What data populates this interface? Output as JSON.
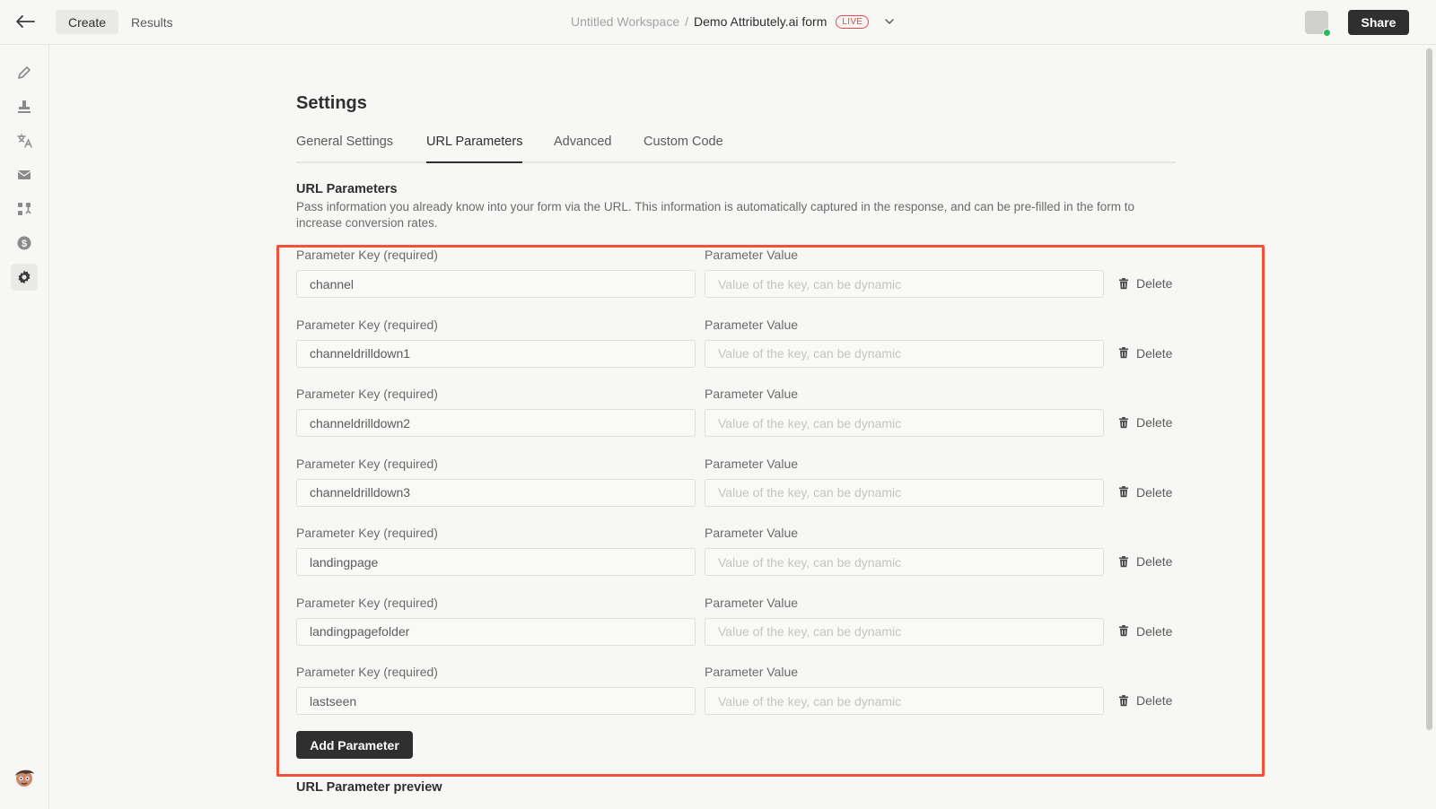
{
  "topbar": {
    "back_icon": "arrow-left-icon",
    "tab_create": "Create",
    "tab_results": "Results",
    "workspace": "Untitled Workspace",
    "separator": "/",
    "form_name": "Demo Attributely.ai form",
    "status_badge": "LIVE",
    "share_label": "Share"
  },
  "sidebar": {
    "icons": [
      "pencil-icon",
      "stamp-icon",
      "translate-icon",
      "mail-icon",
      "workflow-icon",
      "dollar-icon",
      "gear-icon"
    ],
    "active": "gear-icon"
  },
  "settings": {
    "title": "Settings",
    "tabs": [
      "General Settings",
      "URL Parameters",
      "Advanced",
      "Custom Code"
    ],
    "active_tab": "URL Parameters",
    "section_title": "URL Parameters",
    "section_description": "Pass information you already know into your form via the URL. This information is automatically captured in the response, and can be pre-filled in the form to increase conversion rates.",
    "key_label": "Parameter Key (required)",
    "value_label": "Parameter Value",
    "value_placeholder": "Value of the key, can be dynamic",
    "delete_label": "Delete",
    "params": [
      {
        "key": "channel",
        "value": ""
      },
      {
        "key": "channeldrilldown1",
        "value": ""
      },
      {
        "key": "channeldrilldown2",
        "value": ""
      },
      {
        "key": "channeldrilldown3",
        "value": ""
      },
      {
        "key": "landingpage",
        "value": ""
      },
      {
        "key": "landingpagefolder",
        "value": ""
      },
      {
        "key": "lastseen",
        "value": ""
      }
    ],
    "add_button": "Add Parameter",
    "preview_title": "URL Parameter preview"
  },
  "colors": {
    "highlight": "#f0523a",
    "live": "#e5484d",
    "online": "#2eb85c",
    "primary_button": "#2f2f2f"
  }
}
